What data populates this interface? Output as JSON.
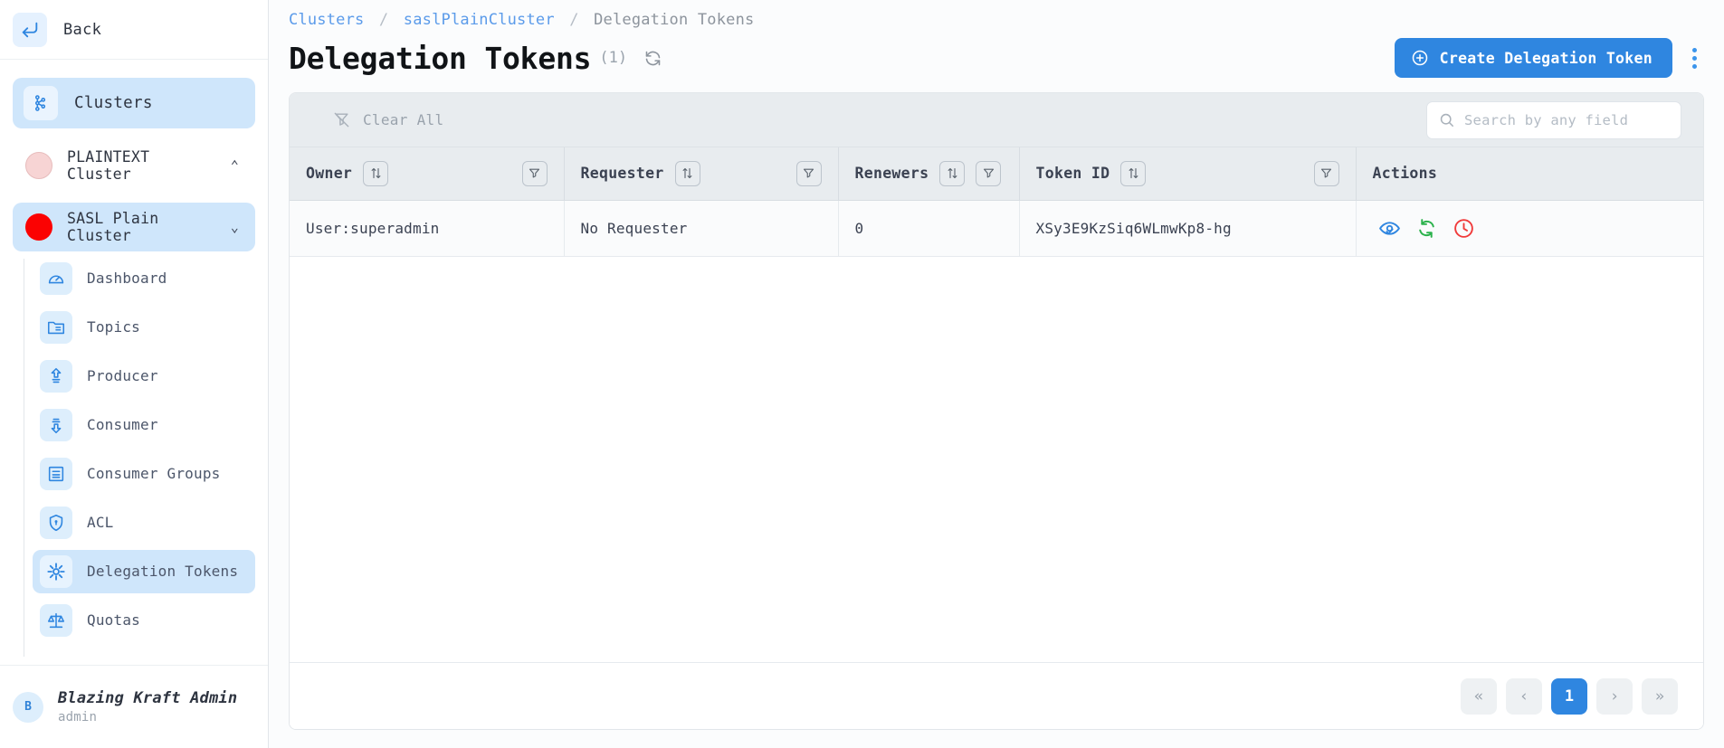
{
  "sidebar": {
    "back_label": "Back",
    "clusters_label": "Clusters",
    "clusters_icon": "cluster-nodes-icon",
    "back_icon": "arrow-left-enter-icon",
    "cluster_entries": [
      {
        "label": "PLAINTEXT Cluster",
        "dot_color": "#f7d4d4",
        "chevron": "⌃",
        "active": false
      },
      {
        "label": "SASL Plain Cluster",
        "dot_color": "#fb0202",
        "chevron": "⌄",
        "active": true
      }
    ],
    "items": [
      {
        "label": "Dashboard",
        "icon": "gauge-icon"
      },
      {
        "label": "Topics",
        "icon": "folder-list-icon"
      },
      {
        "label": "Producer",
        "icon": "upload-arrow-icon"
      },
      {
        "label": "Consumer",
        "icon": "download-arrow-icon"
      },
      {
        "label": "Consumer Groups",
        "icon": "group-list-icon"
      },
      {
        "label": "ACL",
        "icon": "shield-lock-icon"
      },
      {
        "label": "Delegation Tokens",
        "icon": "token-asterisk-icon"
      },
      {
        "label": "Quotas",
        "icon": "scales-balance-icon"
      }
    ],
    "active_item": "Delegation Tokens",
    "user": {
      "initial": "B",
      "name": "Blazing Kraft Admin",
      "role": "admin"
    }
  },
  "header": {
    "breadcrumb": {
      "root": "Clusters",
      "cluster": "saslPlainCluster",
      "current": "Delegation Tokens",
      "separator": "/"
    },
    "title": "Delegation Tokens",
    "count": "(1)",
    "refresh_icon": "refresh-icon",
    "create_button": {
      "label": "Create Delegation Token",
      "icon": "plus-circle-icon",
      "color": "#2f86e0"
    },
    "kebab_icon": "more-vertical-icon"
  },
  "toolbar": {
    "clear_all_label": "Clear All",
    "clear_all_icon": "filter-off-icon",
    "search": {
      "placeholder": "Search by any field",
      "value": "",
      "icon": "search-icon"
    }
  },
  "table": {
    "columns": [
      {
        "label": "Owner",
        "sort": true,
        "filter": true
      },
      {
        "label": "Requester",
        "sort": true,
        "filter": true
      },
      {
        "label": "Renewers",
        "sort": true,
        "filter": true
      },
      {
        "label": "Token ID",
        "sort": true,
        "filter": true
      },
      {
        "label": "Actions",
        "sort": false,
        "filter": false
      }
    ],
    "rows": [
      {
        "owner": "User:superadmin",
        "requester": "No Requester",
        "renewers": "0",
        "token_id": "XSy3E9KzSiq6WLmwKp8-hg",
        "actions": [
          {
            "name": "view-token-icon",
            "color": "#2f86e0"
          },
          {
            "name": "renew-token-icon",
            "color": "#2bb24c"
          },
          {
            "name": "expire-token-icon",
            "color": "#f03a3a"
          }
        ]
      }
    ]
  },
  "pagination": {
    "first": "«",
    "prev": "‹",
    "pages": [
      "1"
    ],
    "current": "1",
    "next": "›",
    "last": "»"
  }
}
